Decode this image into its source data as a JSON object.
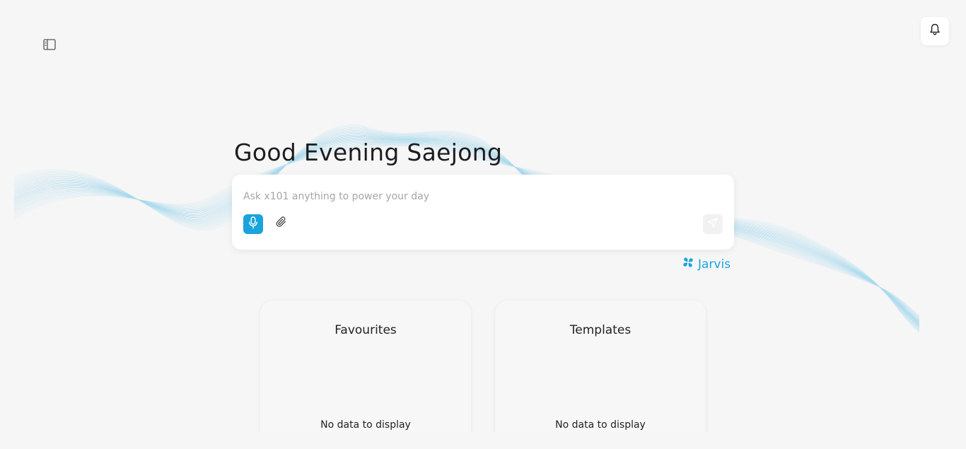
{
  "header": {
    "sidebar_toggle_icon": "sidebar-panel-icon",
    "notification_icon": "bell-icon"
  },
  "greeting": {
    "text": "Good Evening Saejong"
  },
  "composer": {
    "placeholder": "Ask x101 anything to power your day",
    "value": "",
    "mic_icon": "microphone-icon",
    "attach_icon": "paperclip-icon",
    "send_icon": "send-icon"
  },
  "assistant": {
    "label": "Jarvis",
    "icon": "jarvis-logo-icon"
  },
  "cards": {
    "favourites": {
      "title": "Favourites",
      "empty_text": "No data to display"
    },
    "templates": {
      "title": "Templates",
      "empty_text": "No data to display"
    }
  },
  "colors": {
    "background": "#f6f6f6",
    "accent": "#1aa4dc",
    "surface": "#ffffff",
    "placeholder": "#a6a6a6"
  }
}
